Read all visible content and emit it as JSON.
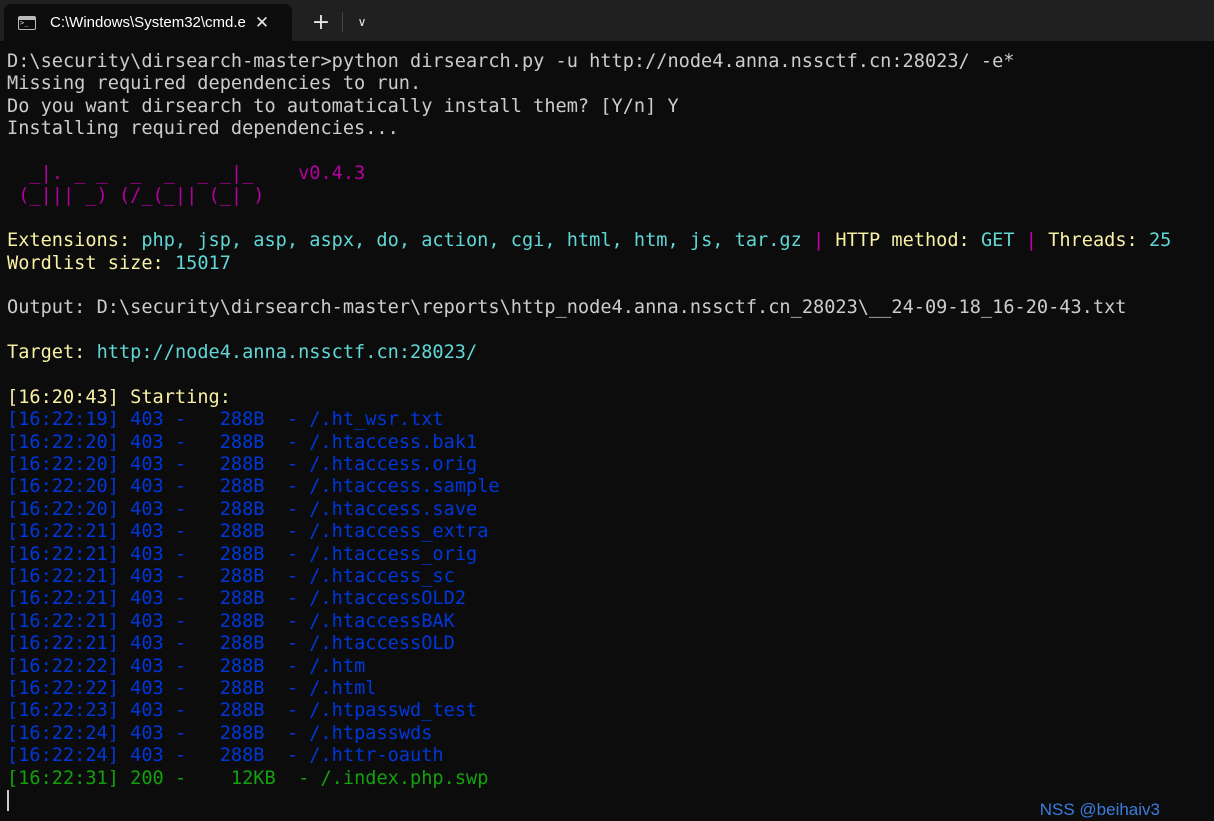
{
  "window": {
    "tab_title": "C:\\Windows\\System32\\cmd.e",
    "icons": {
      "tab": "terminal-icon",
      "close": "close-icon",
      "new_tab": "plus-icon",
      "dropdown": "chevron-down-icon"
    },
    "close_glyph": "✕",
    "new_tab_glyph": "+",
    "dropdown_glyph": "∨"
  },
  "colors": {
    "background": "#0c0c0c",
    "text": "#cccccc",
    "yellow": "#f9f1a5",
    "cyan": "#61d6d6",
    "magenta": "#b4009e",
    "blue": "#0037da",
    "green": "#13a10e"
  },
  "terminal": {
    "command_line": "D:\\security\\dirsearch-master>python dirsearch.py -u http://node4.anna.nssctf.cn:28023/ -e*",
    "missing_deps": "Missing required dependencies to run.",
    "install_prompt": "Do you want dirsearch to automatically install them? [Y/n] Y",
    "installing": "Installing required dependencies...",
    "banner_line1": "  _|. _ _  _  _  _ _|_    ",
    "banner_line2": " (_||| _) (/_(_|| (_| )",
    "version": "v0.4.3",
    "extensions_label": "Extensions:",
    "extensions_value": "php, jsp, asp, aspx, do, action, cgi, html, htm, js, tar.gz",
    "pipe": "|",
    "http_method_label": "HTTP method:",
    "http_method_value": "GET",
    "threads_label": "Threads:",
    "threads_value": "25",
    "wordlist_label": "Wordlist size:",
    "wordlist_value": "15017",
    "output_label": "Output:",
    "output_value": "D:\\security\\dirsearch-master\\reports\\http_node4.anna.nssctf.cn_28023\\__24-09-18_16-20-43.txt",
    "target_label": "Target:",
    "target_value": "http://node4.anna.nssctf.cn:28023/",
    "starting_time": "[16:20:43]",
    "starting_text": "Starting:",
    "results": [
      {
        "time": "[16:22:19]",
        "status": "403",
        "size": " 288B",
        "path": "/.ht_wsr.txt"
      },
      {
        "time": "[16:22:20]",
        "status": "403",
        "size": " 288B",
        "path": "/.htaccess.bak1"
      },
      {
        "time": "[16:22:20]",
        "status": "403",
        "size": " 288B",
        "path": "/.htaccess.orig"
      },
      {
        "time": "[16:22:20]",
        "status": "403",
        "size": " 288B",
        "path": "/.htaccess.sample"
      },
      {
        "time": "[16:22:20]",
        "status": "403",
        "size": " 288B",
        "path": "/.htaccess.save"
      },
      {
        "time": "[16:22:21]",
        "status": "403",
        "size": " 288B",
        "path": "/.htaccess_extra"
      },
      {
        "time": "[16:22:21]",
        "status": "403",
        "size": " 288B",
        "path": "/.htaccess_orig"
      },
      {
        "time": "[16:22:21]",
        "status": "403",
        "size": " 288B",
        "path": "/.htaccess_sc"
      },
      {
        "time": "[16:22:21]",
        "status": "403",
        "size": " 288B",
        "path": "/.htaccessOLD2"
      },
      {
        "time": "[16:22:21]",
        "status": "403",
        "size": " 288B",
        "path": "/.htaccessBAK"
      },
      {
        "time": "[16:22:21]",
        "status": "403",
        "size": " 288B",
        "path": "/.htaccessOLD"
      },
      {
        "time": "[16:22:22]",
        "status": "403",
        "size": " 288B",
        "path": "/.htm"
      },
      {
        "time": "[16:22:22]",
        "status": "403",
        "size": " 288B",
        "path": "/.html"
      },
      {
        "time": "[16:22:23]",
        "status": "403",
        "size": " 288B",
        "path": "/.htpasswd_test"
      },
      {
        "time": "[16:22:24]",
        "status": "403",
        "size": " 288B",
        "path": "/.htpasswds"
      },
      {
        "time": "[16:22:24]",
        "status": "403",
        "size": " 288B",
        "path": "/.httr-oauth"
      },
      {
        "time": "[16:22:31]",
        "status": "200",
        "size": "  12KB",
        "path": "/.index.php.swp"
      }
    ]
  },
  "watermark": "NSS @beihaiv3"
}
